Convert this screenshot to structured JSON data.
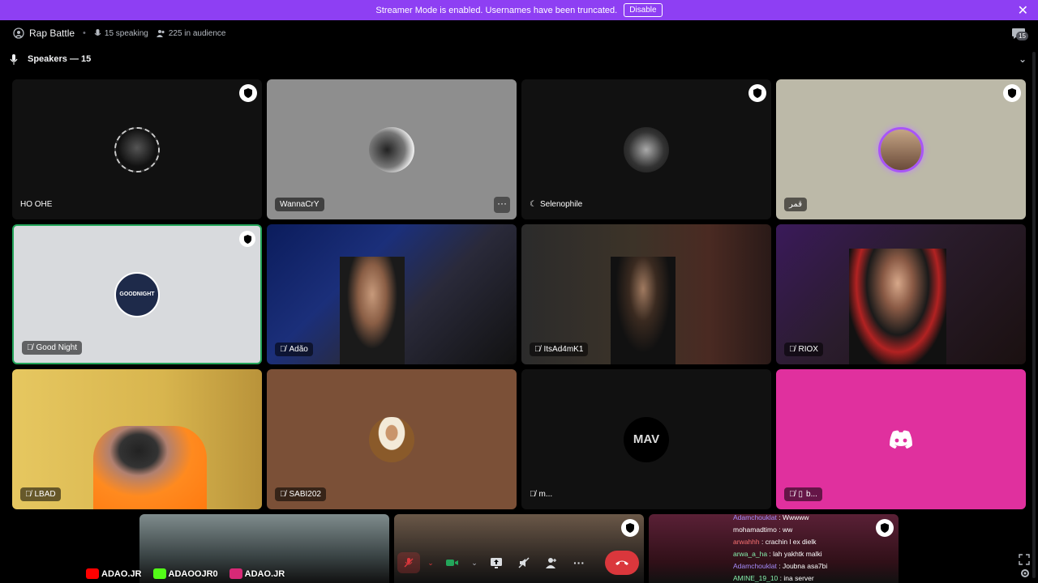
{
  "banner": {
    "text": "Streamer Mode is enabled. Usernames have been truncated.",
    "disable_label": "Disable"
  },
  "header": {
    "title": "Rap Battle",
    "speaking": "15 speaking",
    "audience": "225 in audience",
    "chat_count": "15"
  },
  "speakers_label": "Speakers — 15",
  "tiles": [
    {
      "name": "HO OHE",
      "bg": "#111111"
    },
    {
      "name": "WannaCrY",
      "bg": "#8e8e8e"
    },
    {
      "name": "Selenophile",
      "bg": "#111111"
    },
    {
      "name": "قمر",
      "bg": "#bcb9a8"
    },
    {
      "name": "Good Night",
      "bg": "#d8dadd"
    },
    {
      "name": "Adão",
      "bg": "#1a1f3a"
    },
    {
      "name": "ItsAd4mK1",
      "bg": "#222222"
    },
    {
      "name": "RIOX",
      "bg": "#2a1c2c"
    },
    {
      "name": "LBAD",
      "bg": "#d8b54e"
    },
    {
      "name": "SABI202",
      "bg": "#7b5037"
    },
    {
      "name": "m...",
      "bg": "#111111"
    },
    {
      "name": "b...",
      "bg": "#e0309e"
    }
  ],
  "avatar_text": {
    "goodnight": "GOODNIGHT",
    "mav": "MAV"
  },
  "chat": [
    {
      "user": "Adamchouklat",
      "color": "#a78bfa",
      "text": "Wwwww"
    },
    {
      "user": "mohamadtimo",
      "color": "#ffffff",
      "text": "ww"
    },
    {
      "user": "arwahhh",
      "color": "#f87171",
      "text": "crachin l ex dielk"
    },
    {
      "user": "arwa_a_ha",
      "color": "#86efac",
      "text": "lah yakhtk malki"
    },
    {
      "user": "Adamchouklat",
      "color": "#a78bfa",
      "text": "Joubna asa7bi"
    },
    {
      "user": "AMINE_19_10",
      "color": "#86efac",
      "text": "ina server"
    }
  ],
  "socials": [
    {
      "label": "ADAO.JR",
      "color": "#ff0000"
    },
    {
      "label": "ADAOOJR0",
      "color": "#53fc18"
    },
    {
      "label": "ADAO.JR",
      "color": "#d62976"
    }
  ]
}
